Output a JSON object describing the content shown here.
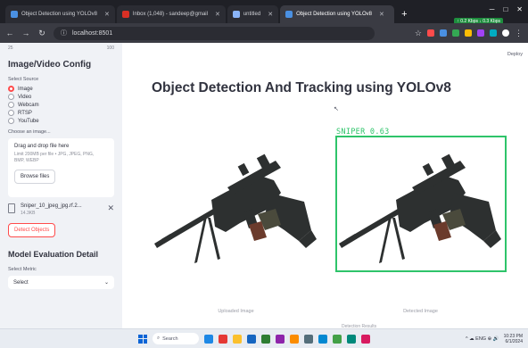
{
  "browser": {
    "tabs": [
      {
        "label": "Object Detection using YOLOv8",
        "active": false,
        "color": "#4a90e2"
      },
      {
        "label": "Inbox (1,048) - sandeep@gmail",
        "active": false,
        "color": "#d93025"
      },
      {
        "label": "untitled",
        "active": false,
        "color": "#8ab4f8"
      },
      {
        "label": "Object Detection using YOLOv8",
        "active": true,
        "color": "#4a90e2"
      }
    ],
    "new_tab": "+",
    "url": "localhost:8501",
    "nav": {
      "back": "←",
      "forward": "→",
      "reload": "↻"
    },
    "window_controls": [
      "─",
      "□",
      "✕"
    ],
    "network_badge": "↑ 0.2 Kbps ↓ 0.3 Kbps",
    "extension_colors": [
      "#ff4b4b",
      "#4a90e2",
      "#34a853",
      "#fbbc05",
      "#a142f4",
      "#00acc1",
      "#ffffff"
    ]
  },
  "sidebar": {
    "ruler_left": "25",
    "ruler_right": "100",
    "config_title": "Image/Video Config",
    "source_label": "Select Source",
    "sources": [
      "Image",
      "Video",
      "Webcam",
      "RTSP",
      "YouTube"
    ],
    "selected_source": "Image",
    "choose_label": "Choose an image...",
    "upload_title": "Drag and drop file here",
    "upload_hint": "Limit 200MB per file • JPG, JPEG, PNG, BMP, WEBP",
    "browse_label": "Browse files",
    "file_name": "Sniper_10_jpeg_jpg.rf.2...",
    "file_size": "14.3KB",
    "file_remove": "✕",
    "detect_label": "Detect Objects",
    "eval_title": "Model Evaluation Detail",
    "select_label": "Select Metric",
    "select_value": "Select",
    "select_arrow": "⌄"
  },
  "main": {
    "deploy_label": "Deploy",
    "title": "Object Detection And Tracking using YOLOv8",
    "cursor_glyph": "↖",
    "left_caption": "Uploaded Image",
    "right_caption": "Detected Image",
    "detection_label": "SNIPER 0.63",
    "bottom_fragment": "Detection Results",
    "box_color": "#2ec46a"
  },
  "taskbar": {
    "search_placeholder": "Search",
    "app_colors": [
      "#1e88e5",
      "#e53935",
      "#fbc02d",
      "#1565c0",
      "#2e7d32",
      "#8e24aa",
      "#fb8c00",
      "#546e7a",
      "#0288d1",
      "#43a047",
      "#00897b",
      "#d81b60"
    ],
    "tray": "^ ☁ ENG ⊕ 🔊",
    "time": "10:23 PM",
    "date": "6/1/2024"
  }
}
